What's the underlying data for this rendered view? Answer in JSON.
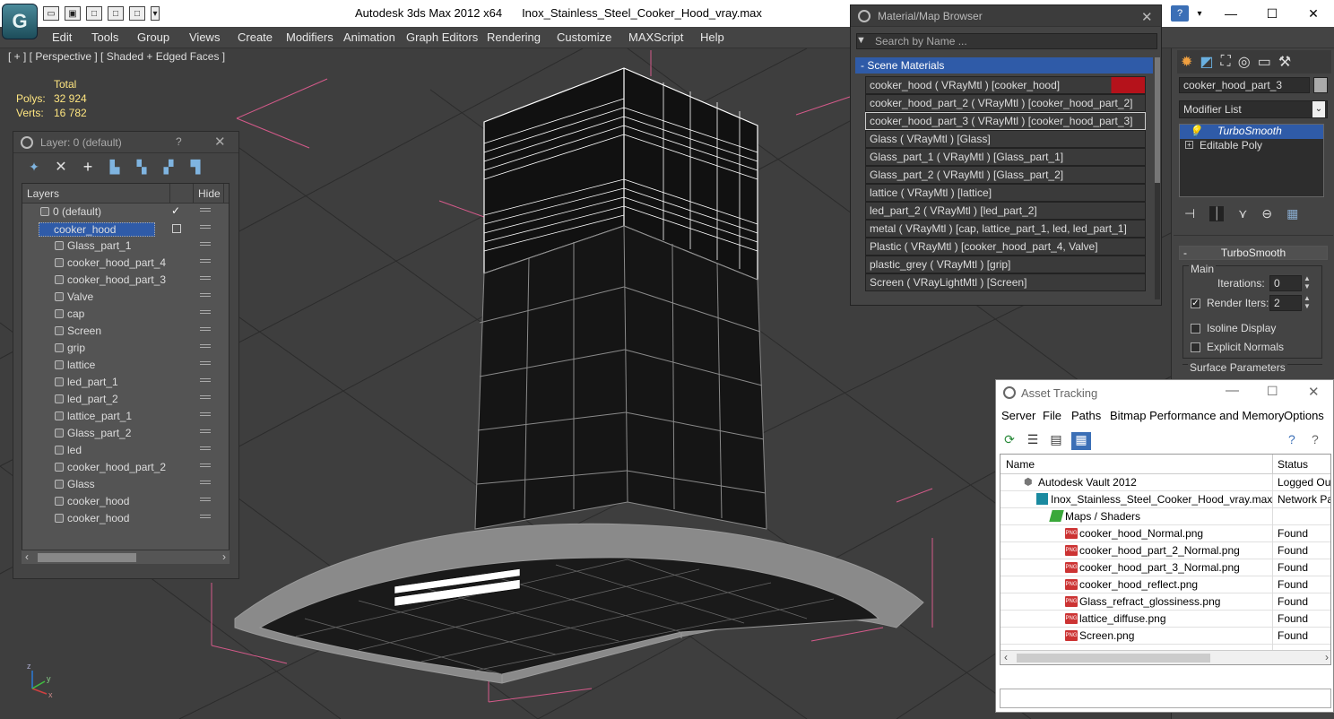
{
  "app": {
    "name": "Autodesk 3ds Max  2012 x64",
    "file": "Inox_Stainless_Steel_Cooker_Hood_vray.max",
    "logo": "3ds-max-logo"
  },
  "menu": [
    "Edit",
    "Tools",
    "Group",
    "Views",
    "Create",
    "Modifiers",
    "Animation",
    "Graph Editors",
    "Rendering",
    "Customize",
    "MAXScript",
    "Help"
  ],
  "viewport": {
    "label": "[ + ] [ Perspective ] [ Shaded + Edged Faces ]",
    "stats": {
      "header": "Total",
      "polys_label": "Polys:",
      "polys": "32 924",
      "verts_label": "Verts:",
      "verts": "16 782"
    },
    "axis": {
      "x": "x",
      "y": "y",
      "z": "z"
    }
  },
  "layer_panel": {
    "title": "Layer: 0 (default)",
    "help": "?",
    "col_layers": "Layers",
    "col_hide": "Hide",
    "items": [
      {
        "name": "0 (default)",
        "level": 0,
        "checked": true
      },
      {
        "name": "cooker_hood",
        "level": 0,
        "selected": true
      },
      {
        "name": "Glass_part_1",
        "level": 1
      },
      {
        "name": "cooker_hood_part_4",
        "level": 1
      },
      {
        "name": "cooker_hood_part_3",
        "level": 1
      },
      {
        "name": "Valve",
        "level": 1
      },
      {
        "name": "cap",
        "level": 1
      },
      {
        "name": "Screen",
        "level": 1
      },
      {
        "name": "grip",
        "level": 1
      },
      {
        "name": "lattice",
        "level": 1
      },
      {
        "name": "led_part_1",
        "level": 1
      },
      {
        "name": "led_part_2",
        "level": 1
      },
      {
        "name": "lattice_part_1",
        "level": 1
      },
      {
        "name": "Glass_part_2",
        "level": 1
      },
      {
        "name": "led",
        "level": 1
      },
      {
        "name": "cooker_hood_part_2",
        "level": 1
      },
      {
        "name": "Glass",
        "level": 1
      },
      {
        "name": "cooker_hood",
        "level": 1
      },
      {
        "name": "cooker_hood",
        "level": 1
      }
    ]
  },
  "material_browser": {
    "title": "Material/Map Browser",
    "search_placeholder": "Search by Name ...",
    "group": "Scene Materials",
    "materials": [
      "cooker_hood  ( VRayMtl ) [cooker_hood]",
      "cooker_hood_part_2  ( VRayMtl ) [cooker_hood_part_2]",
      "cooker_hood_part_3  ( VRayMtl ) [cooker_hood_part_3]",
      "Glass  ( VRayMtl ) [Glass]",
      "Glass_part_1  ( VRayMtl ) [Glass_part_1]",
      "Glass_part_2  ( VRayMtl ) [Glass_part_2]",
      "lattice  ( VRayMtl ) [lattice]",
      "led_part_2  ( VRayMtl ) [led_part_2]",
      "metal  ( VRayMtl ) [cap, lattice_part_1, led, led_part_1]",
      "Plastic  ( VRayMtl ) [cooker_hood_part_4, Valve]",
      "plastic_grey  ( VRayMtl ) [grip]",
      "Screen  ( VRayLightMtl ) [Screen]"
    ]
  },
  "command_panel": {
    "object_name": "cooker_hood_part_3",
    "modifier_list": "Modifier List",
    "stack": [
      "TurboSmooth",
      "Editable Poly"
    ],
    "rollout": "TurboSmooth",
    "group_main": "Main",
    "iterations_label": "Iterations:",
    "iterations": "0",
    "render_iters_label": "Render Iters:",
    "render_iters": "2",
    "isoline": "Isoline Display",
    "explicit_normals": "Explicit Normals",
    "surface_params": "Surface Parameters",
    "collapse": "-"
  },
  "asset_tracking": {
    "title": "Asset Tracking",
    "menus": [
      "Server",
      "File",
      "Paths",
      "Bitmap Performance and Memory",
      "Options"
    ],
    "col_name": "Name",
    "col_status": "Status",
    "rows": [
      {
        "name": "Autodesk Vault 2012",
        "status": "Logged Out",
        "icon": "vault"
      },
      {
        "name": "Inox_Stainless_Steel_Cooker_Hood_vray.max",
        "status": "Network Path",
        "icon": "max"
      },
      {
        "name": "Maps / Shaders",
        "status": "",
        "icon": "maps"
      },
      {
        "name": "cooker_hood_Normal.png",
        "status": "Found",
        "icon": "png"
      },
      {
        "name": "cooker_hood_part_2_Normal.png",
        "status": "Found",
        "icon": "png"
      },
      {
        "name": "cooker_hood_part_3_Normal.png",
        "status": "Found",
        "icon": "png"
      },
      {
        "name": "cooker_hood_reflect.png",
        "status": "Found",
        "icon": "png"
      },
      {
        "name": "Glass_refract_glossiness.png",
        "status": "Found",
        "icon": "png"
      },
      {
        "name": "lattice_diffuse.png",
        "status": "Found",
        "icon": "png"
      },
      {
        "name": "Screen.png",
        "status": "Found",
        "icon": "png"
      }
    ],
    "png_badge": "PNG"
  }
}
